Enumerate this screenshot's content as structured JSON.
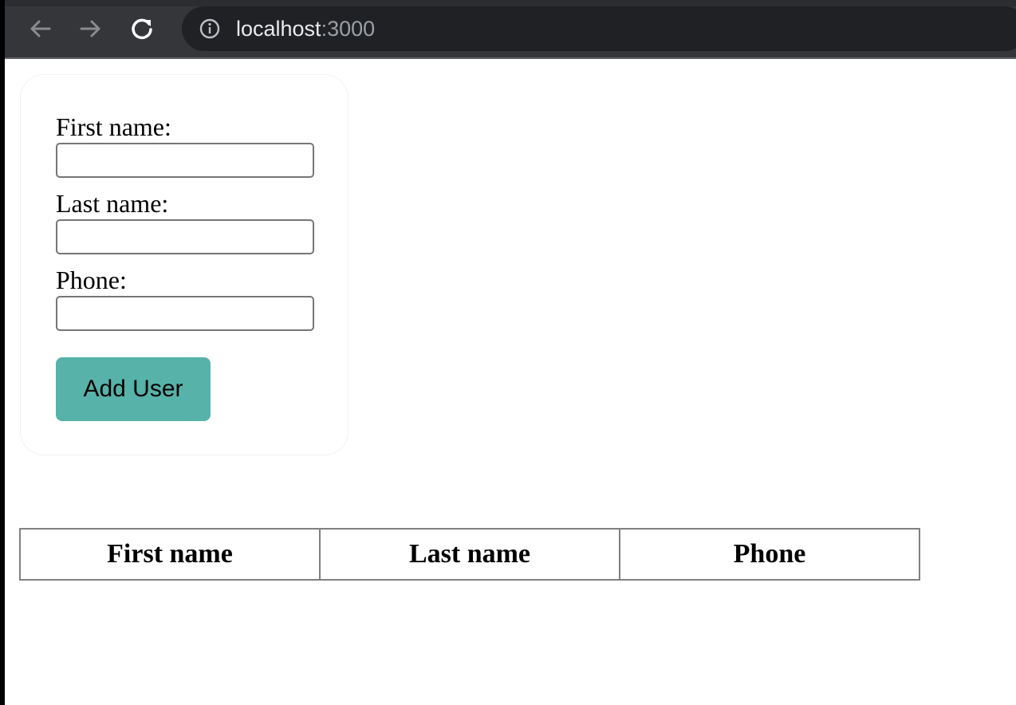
{
  "browser": {
    "back_icon": "arrow-left-icon",
    "forward_icon": "arrow-right-icon",
    "reload_icon": "reload-icon",
    "info_icon": "info-icon",
    "url_host": "localhost",
    "url_port": ":3000"
  },
  "form": {
    "first_name_label": "First name:",
    "first_name_value": "",
    "last_name_label": "Last name:",
    "last_name_value": "",
    "phone_label": "Phone:",
    "phone_value": "",
    "submit_label": "Add User",
    "submit_color": "#57b2a9"
  },
  "table": {
    "columns": [
      "First name",
      "Last name",
      "Phone"
    ],
    "rows": []
  }
}
